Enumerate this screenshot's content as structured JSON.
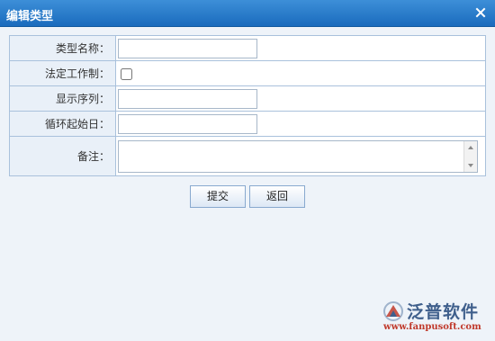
{
  "dialog": {
    "title": "编辑类型",
    "close_icon": "close-icon"
  },
  "form": {
    "type_name": {
      "label": "类型名称：",
      "value": ""
    },
    "statutory_workday": {
      "label": "法定工作制：",
      "checked": false
    },
    "display_order": {
      "label": "显示序列：",
      "value": ""
    },
    "cycle_start_day": {
      "label": "循环起始日：",
      "value": ""
    },
    "remarks": {
      "label": "备注：",
      "value": ""
    }
  },
  "buttons": {
    "submit_label": "提交",
    "back_label": "返回"
  },
  "watermark": {
    "brand": "泛普软件",
    "url": "www.fanpusoft.com"
  }
}
